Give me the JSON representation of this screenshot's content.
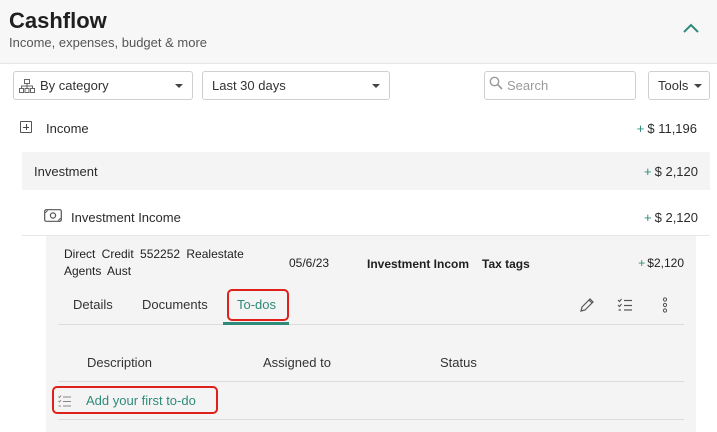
{
  "header": {
    "title": "Cashflow",
    "subtitle": "Income, expenses, budget & more"
  },
  "toolbar": {
    "group_by": "By category",
    "date_range": "Last 30 days",
    "search_placeholder": "Search",
    "tools_label": "Tools"
  },
  "rows": {
    "income": {
      "label": "Income",
      "sign": "+",
      "amount": "$ 11,196"
    },
    "investment": {
      "label": "Investment",
      "sign": "+",
      "amount": "$ 2,120"
    },
    "investment_income": {
      "label": "Investment Income",
      "sign": "+",
      "amount": "$ 2,120"
    }
  },
  "transaction": {
    "description": "Direct Credit 552252 Realestate Agents Aust",
    "date": "05/6/23",
    "category": "Investment Income",
    "tax": "Tax tags",
    "sign": "+",
    "amount": "$2,120"
  },
  "tabs": {
    "details": "Details",
    "documents": "Documents",
    "todos": "To-dos"
  },
  "todo_table": {
    "columns": {
      "description": "Description",
      "assigned": "Assigned to",
      "status": "Status"
    },
    "add_label": "Add your first to-do"
  },
  "colors": {
    "accent": "#2e8b7a",
    "highlight": "#e0201a"
  }
}
